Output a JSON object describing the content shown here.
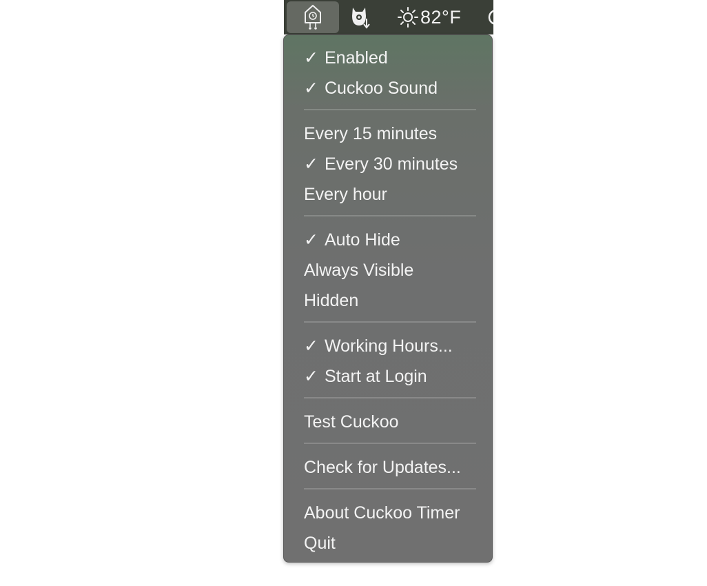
{
  "menubar": {
    "cuckoo_icon": "cuckoo-clock-icon",
    "app2_icon": "cat-download-icon",
    "weather": {
      "icon": "sun-icon",
      "glyph": "☼",
      "text": "82°F"
    }
  },
  "menu": {
    "enabled": {
      "label": "Enabled",
      "check": "✓"
    },
    "cuckoo_sound": {
      "label": "Cuckoo Sound",
      "check": "✓"
    },
    "every_15": {
      "label": "Every 15 minutes",
      "check": ""
    },
    "every_30": {
      "label": "Every 30 minutes",
      "check": "✓"
    },
    "every_hour": {
      "label": "Every hour",
      "check": ""
    },
    "auto_hide": {
      "label": "Auto Hide",
      "check": "✓"
    },
    "always_visible": {
      "label": "Always Visible",
      "check": ""
    },
    "hidden": {
      "label": "Hidden",
      "check": ""
    },
    "working_hours": {
      "label": "Working Hours...",
      "check": "✓"
    },
    "start_at_login": {
      "label": "Start at Login",
      "check": "✓"
    },
    "test_cuckoo": {
      "label": "Test Cuckoo"
    },
    "check_updates": {
      "label": "Check for Updates..."
    },
    "about": {
      "label": "About Cuckoo Timer"
    },
    "quit": {
      "label": "Quit"
    }
  }
}
